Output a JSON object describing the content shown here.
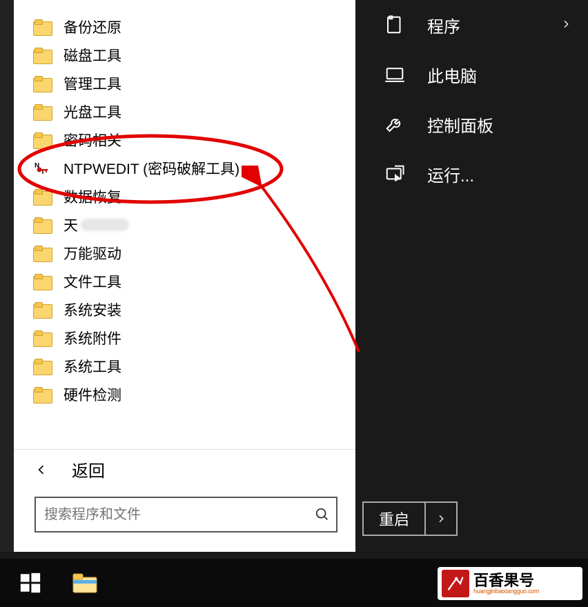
{
  "left_menu": {
    "items": [
      {
        "label": "备份还原",
        "icon": "folder"
      },
      {
        "label": "磁盘工具",
        "icon": "folder"
      },
      {
        "label": "管理工具",
        "icon": "folder"
      },
      {
        "label": "光盘工具",
        "icon": "folder"
      },
      {
        "label": "密码相关",
        "icon": "folder"
      },
      {
        "label": "NTPWEDIT (密码破解工具)",
        "icon": "nt",
        "highlight": true
      },
      {
        "label": "数据恢复",
        "icon": "folder"
      },
      {
        "label": "天",
        "icon": "folder",
        "smudge": true
      },
      {
        "label": "万能驱动",
        "icon": "folder"
      },
      {
        "label": "文件工具",
        "icon": "folder"
      },
      {
        "label": "系统安装",
        "icon": "folder"
      },
      {
        "label": "系统附件",
        "icon": "folder"
      },
      {
        "label": "系统工具",
        "icon": "folder"
      },
      {
        "label": "硬件检测",
        "icon": "folder"
      }
    ],
    "back_label": "返回"
  },
  "search": {
    "placeholder": "搜索程序和文件"
  },
  "right_menu": {
    "items": [
      {
        "label": "程序",
        "icon": "program",
        "chevron": true
      },
      {
        "label": "此电脑",
        "icon": "computer"
      },
      {
        "label": "控制面板",
        "icon": "wrench"
      },
      {
        "label": "运行...",
        "icon": "run"
      }
    ],
    "restart_label": "重启"
  },
  "watermark": {
    "main": "百香果号",
    "sub": "huangjinbaixiangguo.com"
  }
}
